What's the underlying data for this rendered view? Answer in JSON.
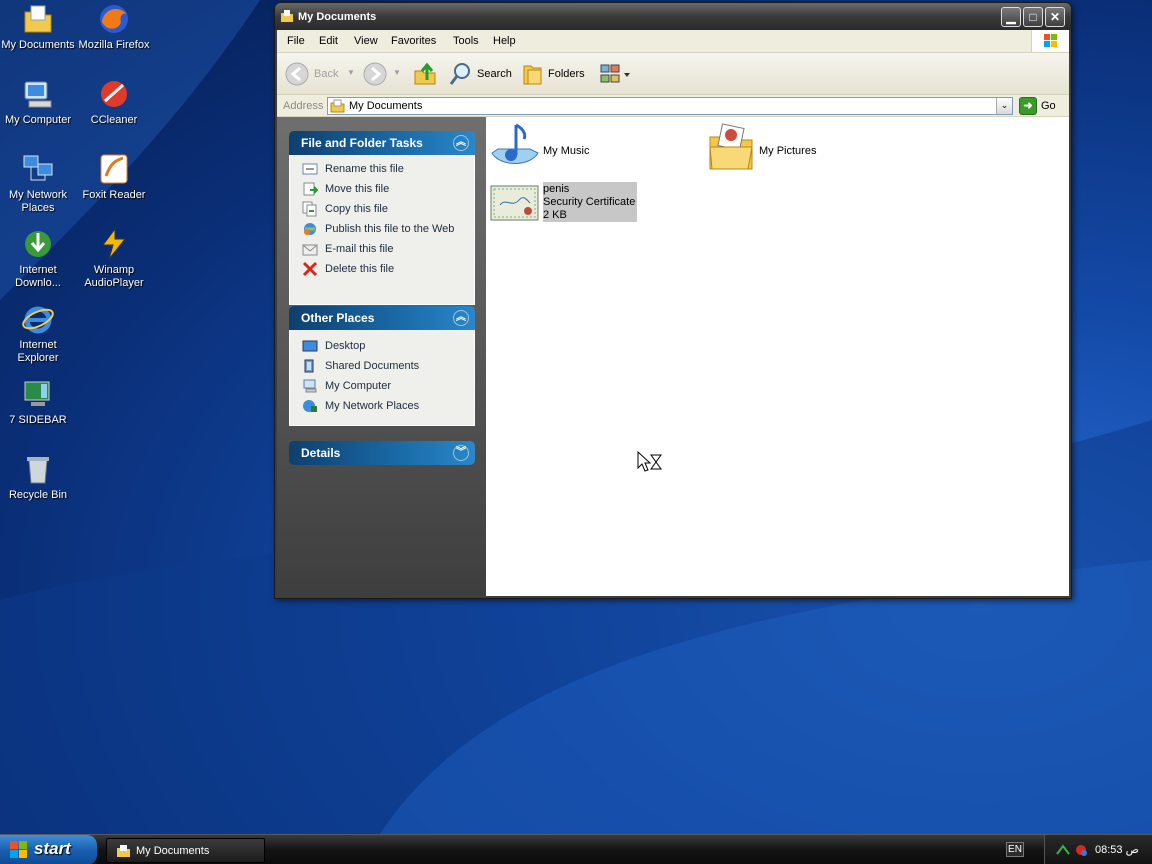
{
  "desktop": {
    "icons": [
      {
        "label": "My Documents",
        "icon": "my-documents-icon"
      },
      {
        "label": "Mozilla Firefox",
        "icon": "firefox-icon"
      },
      {
        "label": "My Computer",
        "icon": "my-computer-icon"
      },
      {
        "label": "CCleaner",
        "icon": "ccleaner-icon"
      },
      {
        "label": "My Network Places",
        "icon": "network-places-icon"
      },
      {
        "label": "Foxit Reader",
        "icon": "foxit-reader-icon"
      },
      {
        "label": "Internet Downlo...",
        "icon": "internet-download-icon"
      },
      {
        "label": "Winamp AudioPlayer",
        "icon": "winamp-icon"
      },
      {
        "label": "Internet Explorer",
        "icon": "internet-explorer-icon"
      },
      {
        "label": "7 SIDEBAR",
        "icon": "sidebar-icon"
      },
      {
        "label": "Recycle Bin",
        "icon": "recycle-bin-icon"
      }
    ]
  },
  "window": {
    "title": "My Documents",
    "menu": [
      "File",
      "Edit",
      "View",
      "Favorites",
      "Tools",
      "Help"
    ],
    "toolbar": {
      "back": "Back",
      "search": "Search",
      "folders": "Folders"
    },
    "address": {
      "label": "Address",
      "value": "My Documents",
      "go": "Go"
    },
    "tasks": {
      "file_folder": {
        "title": "File and Folder Tasks",
        "items": [
          "Rename this file",
          "Move this file",
          "Copy this file",
          "Publish this file to the Web",
          "E-mail this file",
          "Delete this file"
        ]
      },
      "other_places": {
        "title": "Other Places",
        "items": [
          "Desktop",
          "Shared Documents",
          "My Computer",
          "My Network Places"
        ]
      },
      "details": {
        "title": "Details"
      }
    },
    "files": [
      {
        "name": "My Music",
        "icon": "my-music-folder-icon"
      },
      {
        "name": "My Pictures",
        "icon": "my-pictures-folder-icon"
      },
      {
        "name": "penis",
        "type": "Security Certificate",
        "size": "2 KB",
        "icon": "certificate-icon"
      }
    ]
  },
  "taskbar": {
    "start": "start",
    "task": "My Documents",
    "lang": "EN",
    "clock": "08:53 ص"
  },
  "colors": {
    "panel_header": "#1a6ba8",
    "desktop": "#134aa8",
    "window_chrome": "#3a3a3a"
  }
}
